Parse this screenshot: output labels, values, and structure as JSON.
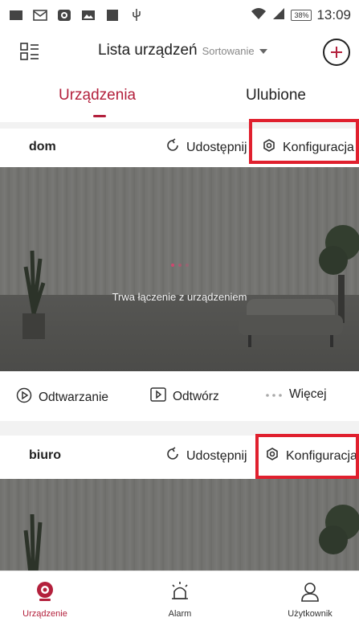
{
  "status_bar": {
    "time": "13:09",
    "battery": "38%"
  },
  "header": {
    "title": "Lista urządzeń",
    "sort_label": "Sortowanie"
  },
  "tabs": [
    {
      "label": "Urządzenia"
    },
    {
      "label": "Ulubione"
    }
  ],
  "devices": [
    {
      "name": "dom",
      "share_label": "Udostępnij",
      "config_label": "Konfiguracja",
      "connecting_text": "Trwa łączenie z urządzeniem",
      "actions": [
        {
          "label": "Odtwarzanie"
        },
        {
          "label": "Odtwórz"
        },
        {
          "label": "Więcej"
        }
      ]
    },
    {
      "name": "biuro",
      "share_label": "Udostępnij",
      "config_label": "Konfiguracja"
    }
  ],
  "bottom_nav": [
    {
      "label": "Urządzenie"
    },
    {
      "label": "Alarm"
    },
    {
      "label": "Użytkownik"
    }
  ],
  "colors": {
    "accent": "#b3203c",
    "highlight": "#e0202e"
  },
  "icons": [
    "mail-icon",
    "gallery-icon",
    "usb-icon",
    "wifi-icon",
    "signal-icon",
    "menu-grid-icon",
    "plus-icon",
    "share-icon",
    "settings-icon",
    "play-circle-icon",
    "play-square-icon",
    "more-icon",
    "camera-icon",
    "alarm-icon",
    "user-icon"
  ]
}
